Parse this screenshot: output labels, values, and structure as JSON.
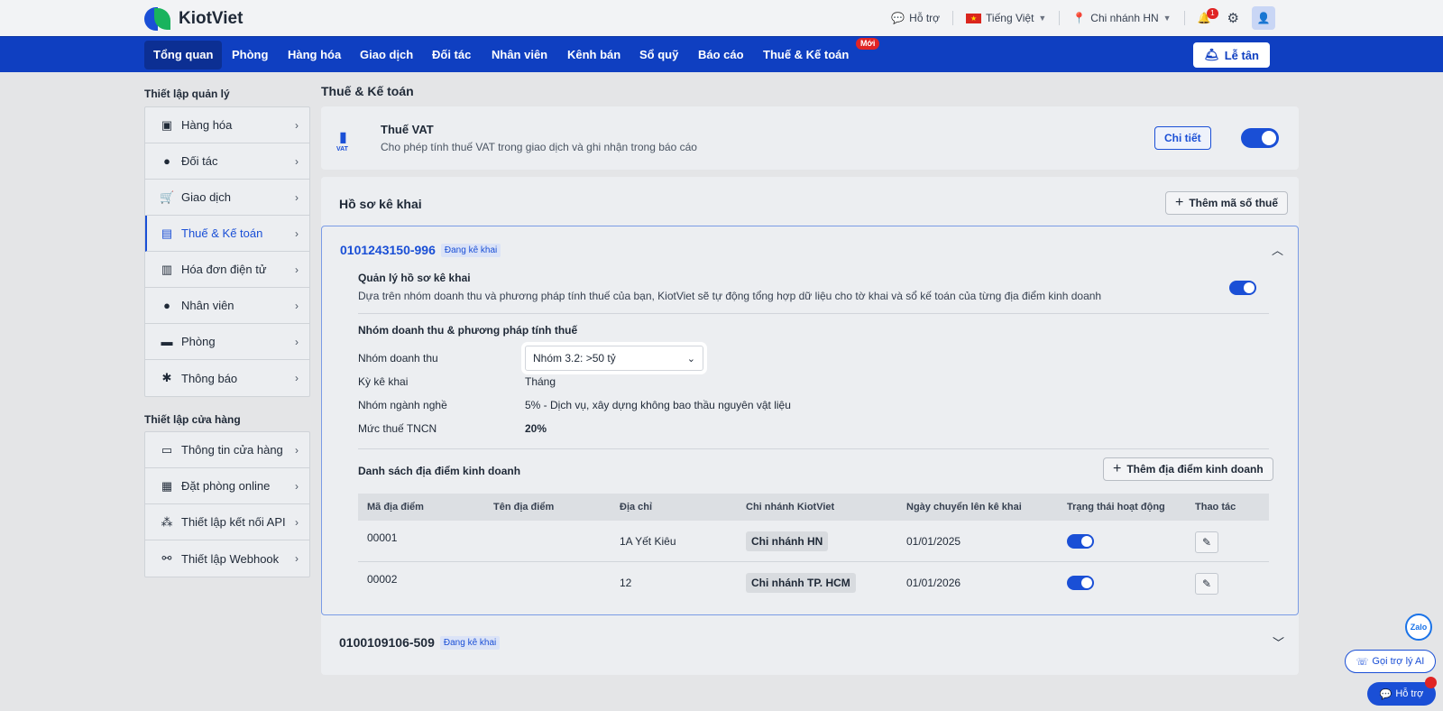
{
  "brand": {
    "name": "KiotViet",
    "accent": "#1a4fd6"
  },
  "topbar": {
    "support": "Hỗ trợ",
    "language": "Tiếng Việt",
    "branch": "Chi nhánh HN",
    "notif_count": "1"
  },
  "nav": {
    "items": [
      "Tổng quan",
      "Phòng",
      "Hàng hóa",
      "Giao dịch",
      "Đối tác",
      "Nhân viên",
      "Kênh bán",
      "Sổ quỹ",
      "Báo cáo",
      "Thuế & Kế toán"
    ],
    "new_badge": "Mới",
    "reception": "Lễ tân"
  },
  "sidebar": {
    "group1_title": "Thiết lập quản lý",
    "group1": [
      "Hàng hóa",
      "Đối tác",
      "Giao dịch",
      "Thuế & Kế toán",
      "Hóa đơn điện tử",
      "Nhân viên",
      "Phòng",
      "Thông báo"
    ],
    "group2_title": "Thiết lập cửa hàng",
    "group2": [
      "Thông tin cửa hàng",
      "Đặt phòng online",
      "Thiết lập kết nối API",
      "Thiết lập Webhook"
    ]
  },
  "main": {
    "title": "Thuế & Kế toán",
    "vat": {
      "title": "Thuế VAT",
      "desc": "Cho phép tính thuế VAT trong giao dịch và ghi nhận trong báo cáo",
      "detail_btn": "Chi tiết",
      "icon_label": "VAT"
    },
    "profile": {
      "title": "Hồ sơ kê khai",
      "add_tax_btn": "Thêm mã số thuế",
      "tax_id": "0101243150-996",
      "status": "Đang kê khai",
      "manage_title": "Quản lý hồ sơ kê khai",
      "manage_desc": "Dựa trên nhóm doanh thu và phương pháp tính thuế của bạn, KiotViet sẽ tự động tổng hợp dữ liệu cho tờ khai và sổ kế toán của từng địa điểm kinh doanh",
      "section_title": "Nhóm doanh thu & phương pháp tính thuế",
      "labels": {
        "revenue_group": "Nhóm doanh thu",
        "period": "Kỳ kê khai",
        "industry": "Nhóm ngành nghề",
        "tncn": "Mức thuế TNCN"
      },
      "values": {
        "revenue_group": "Nhóm 3.2: >50 tỷ",
        "period": "Tháng",
        "industry": "5% - Dịch vụ, xây dựng không bao thầu nguyên vật liệu",
        "tncn": "20%"
      },
      "locations_title": "Danh sách địa điểm kinh doanh",
      "add_location_btn": "Thêm địa điểm kinh doanh",
      "columns": [
        "Mã địa điểm",
        "Tên địa điểm",
        "Địa chỉ",
        "Chi nhánh KiotViet",
        "Ngày chuyển lên kê khai",
        "Trạng thái hoạt động",
        "Thao tác"
      ],
      "rows": [
        {
          "code": "00001",
          "name": "",
          "address": "1A Yết Kiêu",
          "branch": "Chi nhánh HN",
          "date": "01/01/2025"
        },
        {
          "code": "00002",
          "name": "",
          "address": "12",
          "branch": "Chi nhánh TP. HCM",
          "date": "01/01/2026"
        }
      ]
    },
    "profile2": {
      "tax_id": "0100109106-509",
      "status": "Đang kê khai"
    }
  },
  "widgets": {
    "zalo": "Zalo",
    "ai": "Gọi trợ lý AI",
    "help": "Hỗ trợ"
  }
}
